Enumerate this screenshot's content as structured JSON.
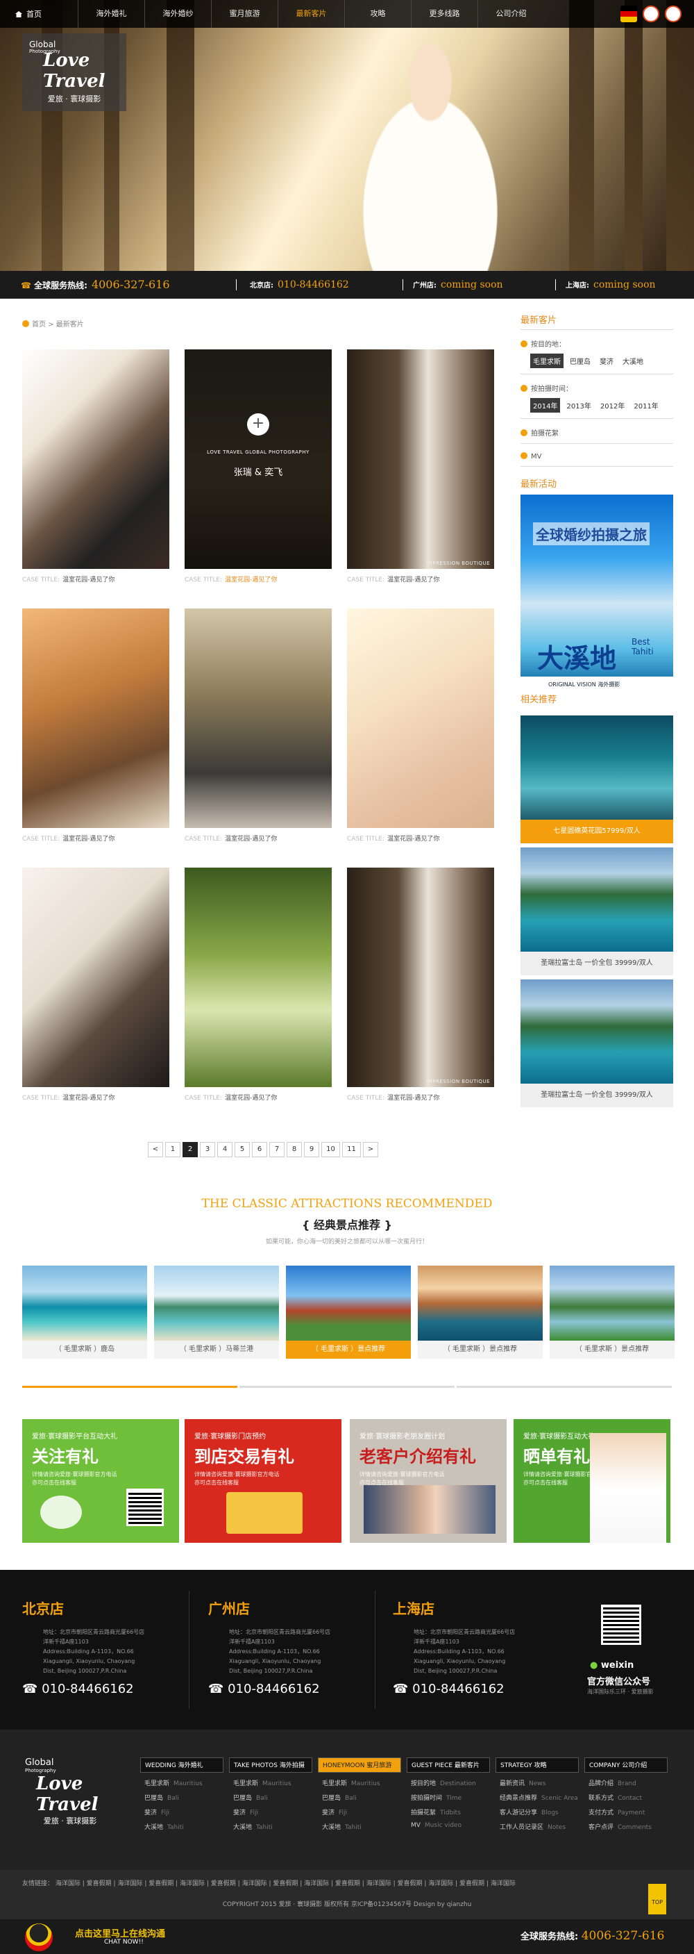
{
  "nav": {
    "home": "首页",
    "items": [
      "海外婚礼",
      "海外婚纱",
      "蜜月旅游",
      "最新客片",
      "攻略",
      "更多线路",
      "公司介绍"
    ],
    "active_index": 3
  },
  "logo": {
    "line1": "Global",
    "line2": "Photography",
    "script": "Love Travel",
    "cn": "爱旅 · 寰球摄影"
  },
  "service_bar": {
    "hotline_label": "全球服务热线:",
    "hotline": "4006-327-616",
    "beijing_label": "北京店:",
    "beijing": "010-84466162",
    "guangzhou_label": "广州店:",
    "guangzhou": "coming soon",
    "shanghai_label": "上海店:",
    "shanghai": "coming soon"
  },
  "breadcrumb": {
    "home": "首页",
    "sep": ">",
    "current": "最新客片"
  },
  "cases": {
    "prefix": "CASE TITLE:",
    "items": [
      {
        "title": "温室花园-遇见了你",
        "active": false
      },
      {
        "title": "温室花园-遇见了你",
        "active": true,
        "overlay_en": "LOVE TRAVEL GLOBAL PHOTOGRAPHY",
        "overlay_names": "张瑞 & 奕飞",
        "plus": "+"
      },
      {
        "title": "温室花园-遇见了你",
        "active": false,
        "watermark": "IMPRESSION BOUTIQUE"
      },
      {
        "title": "温室花园-遇见了你",
        "active": false
      },
      {
        "title": "温室花园-遇见了你",
        "active": false
      },
      {
        "title": "温室花园-遇见了你",
        "active": false
      },
      {
        "title": "温室花园-遇见了你",
        "active": false
      },
      {
        "title": "温室花园-遇见了你",
        "active": false
      },
      {
        "title": "温室花园-遇见了你",
        "active": false,
        "watermark": "IMPRESSION BOUTIQUE"
      }
    ]
  },
  "pagination": {
    "prev": "<",
    "pages": [
      "1",
      "2",
      "3",
      "4",
      "5",
      "6",
      "7",
      "8",
      "9",
      "10",
      "11"
    ],
    "current": "2",
    "next": ">"
  },
  "sidebar": {
    "latest_title": "最新客片",
    "dest_label": "按目的地：",
    "dest_tags": [
      "毛里求斯",
      "巴厘岛",
      "斐济",
      "大溪地"
    ],
    "dest_active": "毛里求斯",
    "time_label": "按拍摄时间：",
    "time_tags": [
      "2014年",
      "2013年",
      "2012年",
      "2011年"
    ],
    "time_active": "2014年",
    "flower_label": "拍摄花絮",
    "mv_label": "MV",
    "activity_title": "最新活动",
    "ad": {
      "headline": "全球婚纱拍摄之旅",
      "brand": "大溪地",
      "best": "Best",
      "tahiti": "Tahiti",
      "original": "ORIGINAL VISION",
      "sub": "海外摄影"
    },
    "related_title": "相关推荐",
    "related": [
      {
        "label": "七星圆礁英花园57999/双人",
        "active": true
      },
      {
        "label": "圣瑞拉富士岛 一价全包 39999/双人",
        "active": false
      },
      {
        "label": "圣瑞拉富士岛 一价全包 39999/双人",
        "active": false
      }
    ]
  },
  "attractions": {
    "title_en": "THE CLASSIC ATTRACTIONS RECOMMENDED",
    "title_cn": "{  经典景点推荐  }",
    "subtitle": "如果可能，你心海一切的美好之旅都可以从哪一次蜜月行！",
    "items": [
      {
        "label": "（ 毛里求斯 ）鹿岛",
        "active": false
      },
      {
        "label": "（ 毛里求斯 ）马蒂兰港",
        "active": false
      },
      {
        "label": "（ 毛里求斯 ）景点推荐",
        "active": true
      },
      {
        "label": "（ 毛里求斯 ）景点推荐",
        "active": false
      },
      {
        "label": "（ 毛里求斯 ）景点推荐",
        "active": false
      }
    ]
  },
  "promos": [
    {
      "small": "爱旅·寰球摄影平台互动大礼",
      "big": "关注有礼",
      "desc": "详情请咨询爱旅·寰球摄影官方电话\n亦可点击在线客服",
      "color": "#6fbf3a"
    },
    {
      "small": "爱旅·寰球摄影门店预约",
      "big": "到店交易有礼",
      "desc": "详情请咨询爱旅·寰球摄影官方电话\n亦可点击在线客服",
      "color": "#d8291f"
    },
    {
      "small": "爱旅·寰球摄影老朋友圈计划",
      "big": "老客户介绍有礼",
      "desc": "详情请咨询爱旅·寰球摄影官方电话\n亦可点击在线客服",
      "color": "#c9c2b8"
    },
    {
      "small": "爱旅·寰球摄影互动大礼",
      "big": "晒单有礼",
      "desc": "详情请咨询爱旅·寰球摄影官方电话\n亦可点击在线客服",
      "color": "#52a62f"
    }
  ],
  "shops": [
    {
      "name": "北京店",
      "addr": "地址：北京市朝阳区青云路商光厦66号店\n洋新千禧A座1103\nAddress:Building A-1103，NO.66\nXiaguangli, Xiaoyunlu, Chaoyang\nDist, Beijing 100027,P.R.China",
      "phone": "010-84466162"
    },
    {
      "name": "广州店",
      "addr": "地址：北京市朝阳区青云路商光厦66号店\n洋新千禧A座1103\nAddress:Building A-1103，NO.66\nXiaguangli, Xiaoyunlu, Chaoyang\nDist, Beijing 100027,P.R.China",
      "phone": "010-84466162"
    },
    {
      "name": "上海店",
      "addr": "地址：北京市朝阳区青云路商光厦66号店\n洋新千禧A座1103\nAddress:Building A-1103，NO.66\nXiaguangli, Xiaoyunlu, Chaoyang\nDist, Beijing 100027,P.R.China",
      "phone": "010-84466162"
    }
  ],
  "weixin": {
    "brand": "weixin",
    "title": "官方微信公众号",
    "sub": "海洋国际乐三环 · 爱旅摄影"
  },
  "footer_nav": [
    {
      "head": "WEDDING 海外婚礼",
      "active": false,
      "items": [
        {
          "cn": "毛里求斯",
          "en": "Mauritius"
        },
        {
          "cn": "巴厘岛",
          "en": "Bali"
        },
        {
          "cn": "斐济",
          "en": "Fiji"
        },
        {
          "cn": "大溪地",
          "en": "Tahiti"
        }
      ]
    },
    {
      "head": "TAKE PHOTOS 海外拍摄",
      "active": false,
      "items": [
        {
          "cn": "毛里求斯",
          "en": "Mauritius"
        },
        {
          "cn": "巴厘岛",
          "en": "Bali"
        },
        {
          "cn": "斐济",
          "en": "Fiji"
        },
        {
          "cn": "大溪地",
          "en": "Tahiti"
        }
      ]
    },
    {
      "head": "HONEYMOON 蜜月旅游",
      "active": true,
      "items": [
        {
          "cn": "毛里求斯",
          "en": "Mauritius"
        },
        {
          "cn": "巴厘岛",
          "en": "Bali"
        },
        {
          "cn": "斐济",
          "en": "Fiji"
        },
        {
          "cn": "大溪地",
          "en": "Tahiti"
        }
      ]
    },
    {
      "head": "GUEST PIECE 最新客片",
      "active": false,
      "items": [
        {
          "cn": "按目的地",
          "en": "Destination"
        },
        {
          "cn": "按拍摄时间",
          "en": "Time"
        },
        {
          "cn": "拍摄花絮",
          "en": "Tidbits"
        },
        {
          "cn": "MV",
          "en": "Music video"
        }
      ]
    },
    {
      "head": "STRATEGY 攻略",
      "active": false,
      "items": [
        {
          "cn": "最新资讯",
          "en": "News"
        },
        {
          "cn": "经典景点推荐",
          "en": "Scenic Area"
        },
        {
          "cn": "客人游记分享",
          "en": "Blogs"
        },
        {
          "cn": "工作人员记录区",
          "en": "Notes"
        }
      ]
    },
    {
      "head": "COMPANY 公司介绍",
      "active": false,
      "items": [
        {
          "cn": "品牌介绍",
          "en": "Brand"
        },
        {
          "cn": "联系方式",
          "en": "Contact"
        },
        {
          "cn": "支付方式",
          "en": "Payment"
        },
        {
          "cn": "客户点评",
          "en": "Comments"
        }
      ]
    }
  ],
  "friend_links": {
    "label": "友情链接：",
    "items": [
      "海洋国际",
      "爱喜假期",
      "海洋国际",
      "爱喜假期",
      "海洋国际",
      "爱喜假期",
      "海洋国际",
      "爱喜假期",
      "海洋国际",
      "爱喜假期",
      "海洋国际",
      "爱喜假期",
      "海洋国际",
      "爱喜假期",
      "海洋国际"
    ]
  },
  "copyright": "COPYRIGHT 2015 爱旅 · 寰球摄影 版权所有  京ICP备01234567号   Design by qianzhu",
  "top_button": "TOP",
  "chat": {
    "cn": "点击这里马上在线沟通",
    "en": "CHAT NOW!!",
    "hotline_label": "全球服务热线:",
    "hotline": "4006-327-616"
  },
  "colors": {
    "accent": "#f2a10c",
    "dark": "#111111"
  }
}
